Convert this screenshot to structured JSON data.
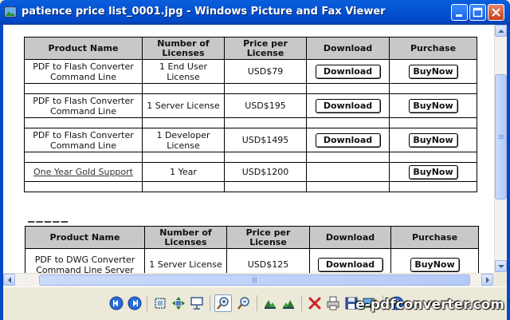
{
  "window": {
    "title": "patience price list_0001.jpg - Windows Picture and Fax Viewer",
    "colors": {
      "titlebar": "#0453d4",
      "close": "#c6401c"
    }
  },
  "table1": {
    "headers": {
      "product": "Product Name",
      "licenses": "Number of Licenses",
      "price": "Price per License",
      "download": "Download",
      "purchase": "Purchase"
    },
    "rows": [
      {
        "product": "PDF to Flash Converter Command Line",
        "licenses": "1 End User License",
        "price": "USD$79",
        "download": "Download",
        "purchase": "BuyNow"
      },
      {
        "product": "PDF to Flash Converter Command Line",
        "licenses": "1 Server License",
        "price": "USD$195",
        "download": "Download",
        "purchase": "BuyNow"
      },
      {
        "product": "PDF to Flash Converter Command Line",
        "licenses": "1 Developer License",
        "price": "USD$1495",
        "download": "Download",
        "purchase": "BuyNow"
      },
      {
        "product": "One Year Gold Support",
        "licenses": "1 Year",
        "price": "USD$1200",
        "download": "",
        "purchase": "BuyNow"
      }
    ]
  },
  "table2": {
    "headers": {
      "product": "Product Name",
      "licenses": "Number of Licenses",
      "price": "Price per License",
      "download": "Download",
      "purchase": "Purchase"
    },
    "rows": [
      {
        "product": "PDF to DWG Converter Command Line Server",
        "licenses": "1 Server License",
        "price": "USD$125",
        "download": "Download",
        "purchase": "BuyNow"
      }
    ]
  },
  "watermark": "e-pdfconverter.com",
  "icons": {
    "previous": "previous-image-icon",
    "next": "next-image-icon",
    "best_fit": "best-fit-icon",
    "actual_size": "actual-size-icon",
    "slideshow": "slideshow-icon",
    "zoom_in": "zoom-in-icon",
    "zoom_out": "zoom-out-icon",
    "rotate_cw": "rotate-clockwise-icon",
    "rotate_ccw": "rotate-counterclockwise-icon",
    "delete": "delete-icon",
    "print": "print-icon",
    "save": "save-icon",
    "open_with": "edit-icon",
    "help": "help-icon"
  }
}
